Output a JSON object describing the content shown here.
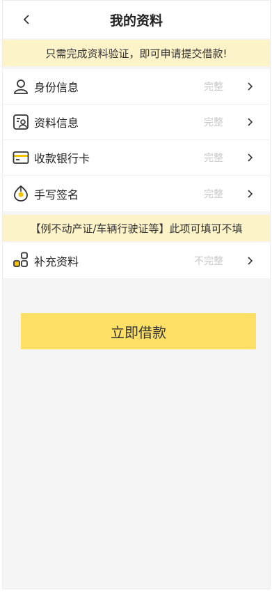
{
  "header": {
    "title": "我的资料"
  },
  "notice_top": "只需完成资料验证，即可申请提交借款!",
  "items": [
    {
      "label": "身份信息",
      "status": "完整"
    },
    {
      "label": "资料信息",
      "status": "完整"
    },
    {
      "label": "收款银行卡",
      "status": "完整"
    },
    {
      "label": "手写签名",
      "status": "完整"
    }
  ],
  "notice_optional": "【例不动产证/车辆行驶证等】此项可填可不填",
  "extra_item": {
    "label": "补充资料",
    "status": "不完整"
  },
  "apply_button": "立即借款",
  "colors": {
    "accent": "#ffe066",
    "notice_bg": "#fdf3c8",
    "icon": "#333333",
    "icon_accent": "#f5c400"
  }
}
